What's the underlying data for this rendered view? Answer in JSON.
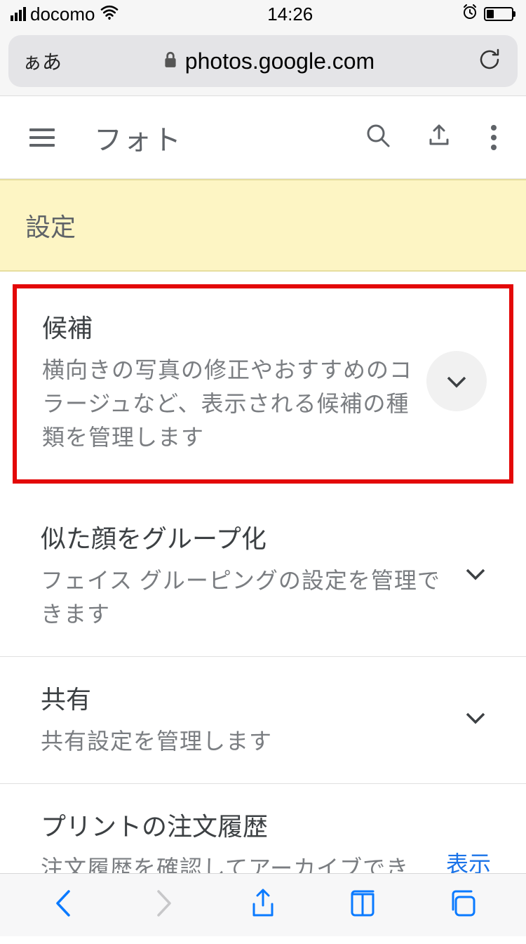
{
  "status_bar": {
    "carrier": "docomo",
    "time": "14:26"
  },
  "url_bar": {
    "reader_label": "ぁあ",
    "domain": "photos.google.com"
  },
  "app_header": {
    "title": "フォト"
  },
  "banner": {
    "title": "設定"
  },
  "settings": [
    {
      "title": "候補",
      "desc": "横向きの写真の修正やおすすめのコラージュなど、表示される候補の種類を管理します",
      "action_type": "chevron_circle",
      "highlighted": true
    },
    {
      "title": "似た顔をグループ化",
      "desc": "フェイス グルーピングの設定を管理できます",
      "action_type": "chevron",
      "highlighted": false
    },
    {
      "title": "共有",
      "desc": "共有設定を管理します",
      "action_type": "chevron",
      "highlighted": false
    },
    {
      "title": "プリントの注文履歴",
      "desc": "注文履歴を確認してアーカイブできます",
      "action_type": "link",
      "action_label": "表示",
      "highlighted": false
    }
  ]
}
